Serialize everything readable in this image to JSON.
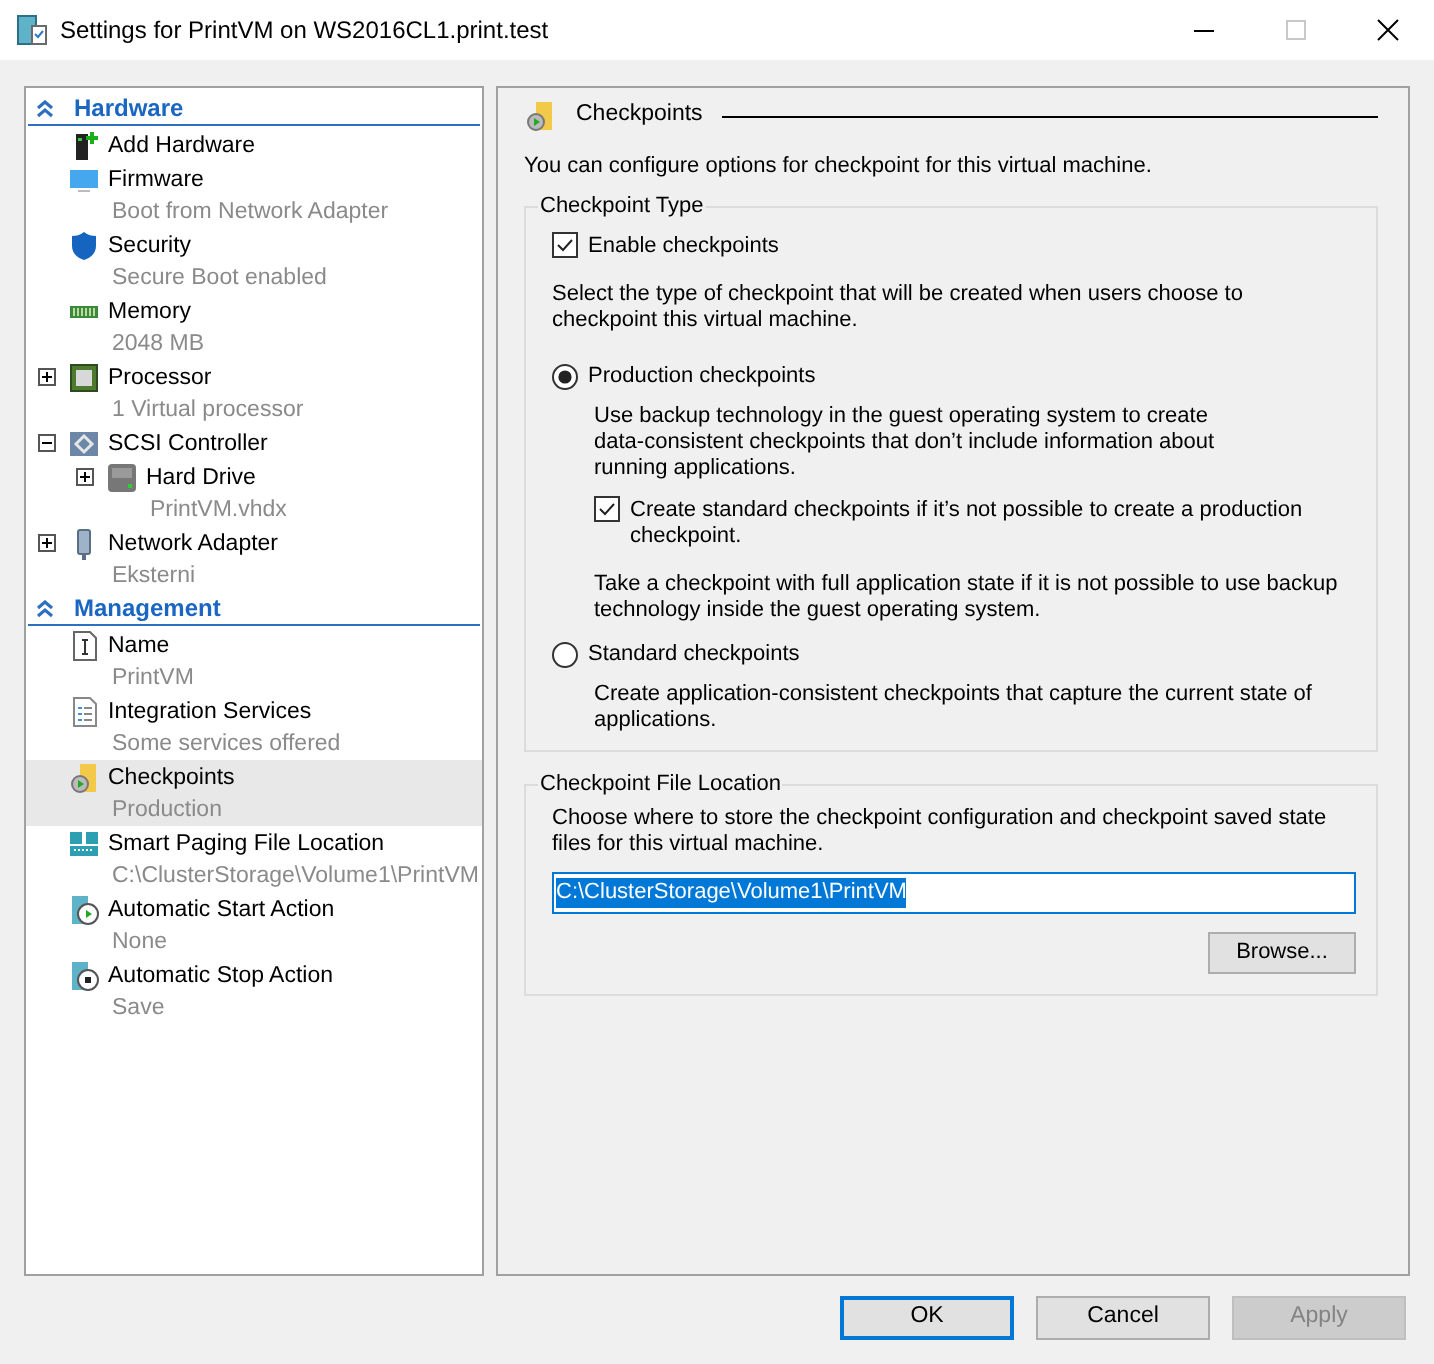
{
  "window": {
    "title": "Settings for PrintVM on WS2016CL1.print.test"
  },
  "sidebar": {
    "sections": [
      {
        "title": "Hardware",
        "expanded": true,
        "items": [
          {
            "kind": "add",
            "label": "Add Hardware",
            "selected": false
          },
          {
            "kind": "monitor",
            "label": "Firmware",
            "detail": "Boot from Network Adapter",
            "selected": false
          },
          {
            "kind": "shield",
            "label": "Security",
            "detail": "Secure Boot enabled",
            "selected": false
          },
          {
            "kind": "memory",
            "label": "Memory",
            "detail": "2048 MB",
            "selected": false
          },
          {
            "kind": "chip",
            "label": "Processor",
            "detail": "1 Virtual processor",
            "selected": false,
            "expanded": false
          },
          {
            "kind": "controller",
            "label": "SCSI Controller",
            "selected": false,
            "expanded": true,
            "children": [
              {
                "kind": "drive",
                "label": "Hard Drive",
                "detail": "PrintVM.vhdx",
                "selected": false,
                "expanded": false
              }
            ]
          },
          {
            "kind": "network",
            "label": "Network Adapter",
            "detail": "Eksterni",
            "selected": false,
            "expanded": false
          }
        ]
      },
      {
        "title": "Management",
        "expanded": true,
        "items": [
          {
            "kind": "name",
            "label": "Name",
            "detail": "PrintVM",
            "selected": false
          },
          {
            "kind": "document",
            "label": "Integration Services",
            "detail": "Some services offered",
            "selected": false
          },
          {
            "kind": "checkpoint",
            "label": "Checkpoints",
            "detail": "Production",
            "selected": true
          },
          {
            "kind": "paging",
            "label": "Smart Paging File Location",
            "detail": "C:\\ClusterStorage\\Volume1\\PrintVM",
            "selected": false
          },
          {
            "kind": "start",
            "label": "Automatic Start Action",
            "detail": "None",
            "selected": false
          },
          {
            "kind": "stop",
            "label": "Automatic Stop Action",
            "detail": "Save",
            "selected": false
          }
        ]
      }
    ]
  },
  "panel": {
    "title": "Checkpoints",
    "intro": "You can configure options for checkpoint for this virtual machine.",
    "type_group": {
      "title": "Checkpoint Type",
      "enable": {
        "label": "Enable checkpoints",
        "checked": true
      },
      "prompt": "Select the type of checkpoint that will be created when users choose to checkpoint this virtual machine.",
      "options": [
        {
          "label": "Production checkpoints",
          "selected": true,
          "description": "Use backup technology in the guest operating system to create data-consistent checkpoints that don’t include information about running applications.",
          "fallback": {
            "label": "Create standard checkpoints if it’s not possible to create a production checkpoint.",
            "checked": true
          },
          "note": "Take a checkpoint with full application state if it is not possible to use backup technology inside the guest operating system."
        },
        {
          "label": "Standard checkpoints",
          "selected": false,
          "description": "Create application-consistent checkpoints that capture the current state of applications."
        }
      ]
    },
    "location_group": {
      "title": "Checkpoint File Location",
      "description": "Choose where to store the checkpoint configuration and checkpoint saved state files for this virtual machine.",
      "path": "C:\\ClusterStorage\\Volume1\\PrintVM",
      "browse": "Browse..."
    }
  },
  "buttons": [
    {
      "label": "OK",
      "default": true,
      "disabled": false
    },
    {
      "label": "Cancel",
      "default": false,
      "disabled": false
    },
    {
      "label": "Apply",
      "default": false,
      "disabled": true
    }
  ]
}
